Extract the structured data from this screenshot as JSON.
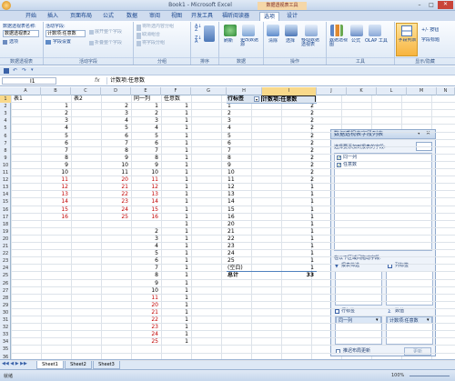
{
  "window": {
    "title": "Book1 - Microsoft Excel",
    "context_tab_group": "数据透视表工具"
  },
  "tabs": [
    "开始",
    "插入",
    "页面布局",
    "公式",
    "数据",
    "审阅",
    "视图",
    "开发工具",
    "福昕阅读器",
    "选项",
    "设计"
  ],
  "active_tab": "选项",
  "ribbon": {
    "pivot_name_label": "数据透视表名称:",
    "pivot_name_value": "数据透视表2",
    "options_button": "选项",
    "active_field_label": "活动字段:",
    "active_field_value": "计数项:任意数",
    "field_settings": "字段设置",
    "expand_field": "展开整个字段",
    "collapse_field": "折叠整个字段",
    "group_selection": "将所选内容分组",
    "ungroup": "取消组合",
    "group_field": "将字段分组",
    "refresh": "刷新",
    "change_source": "更改数据源",
    "clear": "清除",
    "select": "选择",
    "move_pivot": "移动数据透视表",
    "summarize_by": "数据透视图",
    "formulas": "公式",
    "olap_tools": "OLAP 工具",
    "field_list": "字段列表",
    "buttons": "+/- 按钮",
    "field_headers": "字段标题",
    "groups": [
      "数据透视表",
      "活动字段",
      "分组",
      "排序",
      "数据",
      "操作",
      "工具",
      "显示/隐藏"
    ]
  },
  "formula_bar": {
    "name_box": "I1",
    "fx": "fx",
    "content": "计数项:任意数"
  },
  "columns": [
    "A",
    "B",
    "C",
    "D",
    "E",
    "F",
    "G",
    "H",
    "I",
    "J",
    "K",
    "L",
    "M",
    "N"
  ],
  "sheet": {
    "headers": {
      "A1": "表1",
      "C1": "表2",
      "E1": "同一列",
      "F1": "任意数"
    },
    "tbl1": [
      1,
      2,
      3,
      4,
      5,
      6,
      7,
      8,
      9,
      10,
      11,
      12,
      13,
      14,
      15,
      16
    ],
    "tbl1_red_from": 11,
    "tbl2": [
      2,
      3,
      4,
      5,
      6,
      7,
      8,
      9,
      10,
      11,
      20,
      21,
      22,
      23,
      24,
      25
    ],
    "tbl2_red_from": 20,
    "same_col": [
      1,
      2,
      3,
      4,
      5,
      6,
      7,
      8,
      9,
      10,
      11,
      12,
      13,
      14,
      15,
      16,
      "",
      2,
      3,
      4,
      5,
      6,
      7,
      8,
      9,
      10,
      11,
      20,
      21,
      22,
      23,
      24,
      25
    ],
    "same_col_red": [
      11,
      12,
      13,
      14,
      15,
      16,
      20,
      21,
      22,
      23,
      24,
      25
    ],
    "any_num_count": 33
  },
  "pivot": {
    "row_label_header": "行标签",
    "value_header": "计数项:任意数",
    "rows": [
      {
        "label": "1",
        "value": "2"
      },
      {
        "label": "2",
        "value": "2"
      },
      {
        "label": "3",
        "value": "2"
      },
      {
        "label": "4",
        "value": "2"
      },
      {
        "label": "5",
        "value": "2"
      },
      {
        "label": "6",
        "value": "2"
      },
      {
        "label": "7",
        "value": "2"
      },
      {
        "label": "8",
        "value": "2"
      },
      {
        "label": "9",
        "value": "2"
      },
      {
        "label": "10",
        "value": "2"
      },
      {
        "label": "11",
        "value": "2"
      },
      {
        "label": "12",
        "value": "1"
      },
      {
        "label": "13",
        "value": "1"
      },
      {
        "label": "14",
        "value": "1"
      },
      {
        "label": "15",
        "value": "1"
      },
      {
        "label": "16",
        "value": "1"
      },
      {
        "label": "20",
        "value": "1"
      },
      {
        "label": "21",
        "value": "1"
      },
      {
        "label": "22",
        "value": "1"
      },
      {
        "label": "23",
        "value": "1"
      },
      {
        "label": "24",
        "value": "1"
      },
      {
        "label": "25",
        "value": "1"
      },
      {
        "label": "(空白)",
        "value": "1"
      }
    ],
    "total_label": "总计",
    "total_value": "33"
  },
  "field_list": {
    "title": "数据透视表字段列表",
    "choose_label": "选择要添加到报表的字段:",
    "fields": [
      {
        "name": "同一列",
        "checked": true
      },
      {
        "name": "任意数",
        "checked": true
      }
    ],
    "drag_label": "在以下区域间拖动字段:",
    "report_filter": "报表筛选",
    "column_labels": "列标签",
    "row_labels": "行标签",
    "values": "数值",
    "row_field": "同一列",
    "value_field": "计数项:任意数",
    "defer_update": "推迟布局更新",
    "update_button": "更新"
  },
  "sheet_tabs": [
    "Sheet1",
    "Sheet2",
    "Sheet3"
  ],
  "status": {
    "ready": "就绪",
    "zoom": "100%"
  }
}
